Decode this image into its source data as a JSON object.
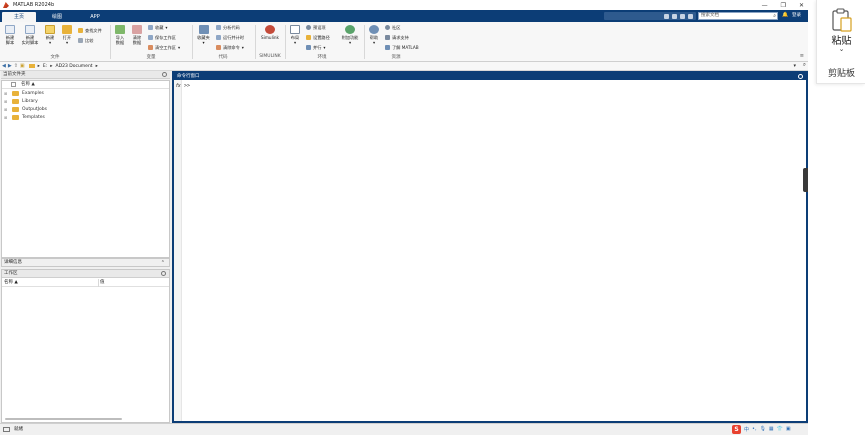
{
  "window": {
    "title": "MATLAB R2024b",
    "controls": [
      "—",
      "❐",
      "✕"
    ]
  },
  "tabs": [
    {
      "label": "主页",
      "active": true
    },
    {
      "label": "绘图",
      "active": false
    },
    {
      "label": "APP",
      "active": false
    }
  ],
  "header": {
    "search_placeholder": "搜索文档",
    "login_label": "登录"
  },
  "ribbon": {
    "file": {
      "new_script": "新建\n脚本",
      "new_live_script": "新建\n实时脚本",
      "new": "新建",
      "open": "打开",
      "find_files": "查找文件",
      "compare": "比较",
      "group": "文件"
    },
    "variable": {
      "import": "导入\n数据",
      "clean": "清除\n数据",
      "favorites": "收藏",
      "save_ws": "保存工作区",
      "clear_ws": "清空工作区",
      "group": "变量"
    },
    "code": {
      "favorites": "收藏夹",
      "analyze": "分析代码",
      "run_timer": "运行并计时",
      "clear_cmds": "清除命令",
      "group": "代码"
    },
    "simulink": {
      "label": "Simulink",
      "group": "SIMULINK"
    },
    "env": {
      "layout": "布局",
      "prefs": "预设项",
      "set_path": "设置路径",
      "parallel": "并行",
      "addons": "附加功能",
      "group": "环境"
    },
    "resources": {
      "help": "帮助",
      "community": "社区",
      "request_support": "请求支持",
      "learn": "了解 MATLAB",
      "group": "资源"
    }
  },
  "address": {
    "segments": [
      "E:",
      "AD23 Document"
    ]
  },
  "file_browser": {
    "title": "当前文件夹",
    "col_name": "名称 ▲",
    "items": [
      "Examples",
      "Library",
      "OutputJobs",
      "Templates"
    ]
  },
  "details": {
    "label": "详细信息"
  },
  "workspace": {
    "title": "工作区",
    "col_name": "名称 ▲",
    "col_value": "值"
  },
  "command_window": {
    "title": "命令行窗口",
    "fx": "fx",
    "prompt": ">>"
  },
  "status": {
    "text": "就绪"
  },
  "ime": {
    "sogou": "S",
    "lang": "中"
  },
  "clipboard": {
    "paste": "粘贴",
    "group": "剪贴板"
  }
}
